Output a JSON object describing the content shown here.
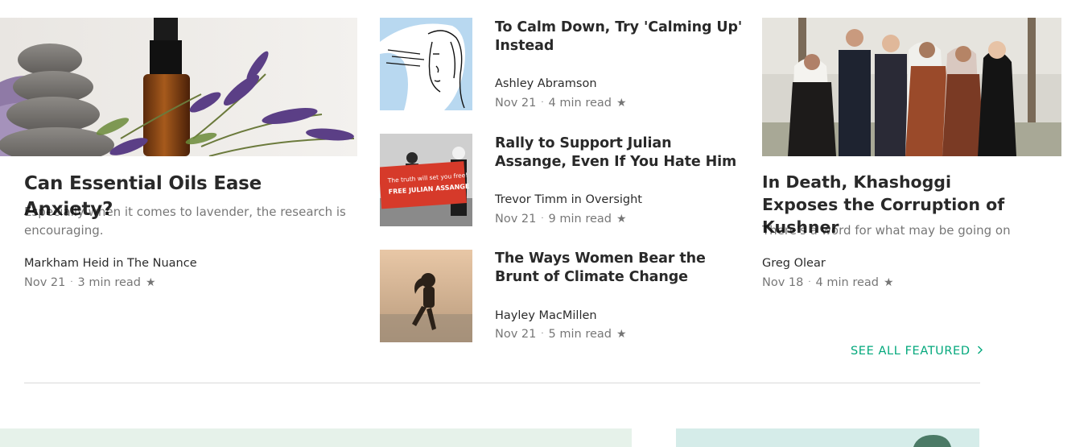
{
  "featured": {
    "main": {
      "title": "Can Essential Oils Ease Anxiety?",
      "description": "Especially when it comes to lavender, the research is encouraging.",
      "author": "Markham Heid in The Nuance",
      "date": "Nov 21",
      "read_time": "3 min read"
    },
    "list": [
      {
        "title": "To Calm Down, Try 'Calming Up' Instead",
        "author": "Ashley Abramson",
        "date": "Nov 21",
        "read_time": "4 min read"
      },
      {
        "title": "Rally to Support Julian Assange, Even If You Hate Him",
        "author": "Trevor Timm in Oversight",
        "date": "Nov 21",
        "read_time": "9 min read",
        "banner_text": "The truth will set you free!",
        "banner_text2": "FREE JULIAN ASSANGE"
      },
      {
        "title": "The Ways Women Bear the Brunt of Climate Change",
        "author": "Hayley MacMillen",
        "date": "Nov 21",
        "read_time": "5 min read"
      }
    ],
    "side": {
      "title": "In Death, Khashoggi Exposes the Corruption of Kushner",
      "description": "There's a word for what may be going on h",
      "author": "Greg Olear",
      "date": "Nov 18",
      "read_time": "4 min read"
    },
    "see_all": "SEE ALL FEATURED",
    "accent": "#03a87c"
  },
  "separator_dot": "·",
  "star": "★"
}
